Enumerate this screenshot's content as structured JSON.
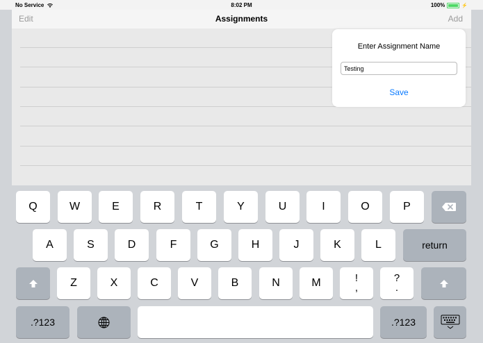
{
  "status_bar": {
    "carrier": "No Service",
    "time": "8:02 PM",
    "battery": "100%"
  },
  "nav": {
    "edit": "Edit",
    "title": "Assignments",
    "add": "Add"
  },
  "popover": {
    "title": "Enter Assignment Name",
    "input_value": "Testing",
    "save": "Save"
  },
  "keyboard": {
    "row1": [
      "Q",
      "W",
      "E",
      "R",
      "T",
      "Y",
      "U",
      "I",
      "O",
      "P"
    ],
    "row2": [
      "A",
      "S",
      "D",
      "F",
      "G",
      "H",
      "J",
      "K",
      "L"
    ],
    "return": "return",
    "row3": [
      "Z",
      "X",
      "C",
      "V",
      "B",
      "N",
      "M"
    ],
    "punct": [
      {
        "top": "!",
        "bottom": ","
      },
      {
        "top": "?",
        "bottom": "."
      }
    ],
    "numbers": ".?123",
    "icons": [
      "delete-icon",
      "shift-icon",
      "globe-icon",
      "keyboard-dismiss-icon",
      "wifi-icon",
      "battery-icon"
    ]
  },
  "colors": {
    "accent": "#0a7aff",
    "battery": "#4cd964",
    "keyboard_bg": "#d1d4d8",
    "dark_key": "#acb3bb"
  }
}
